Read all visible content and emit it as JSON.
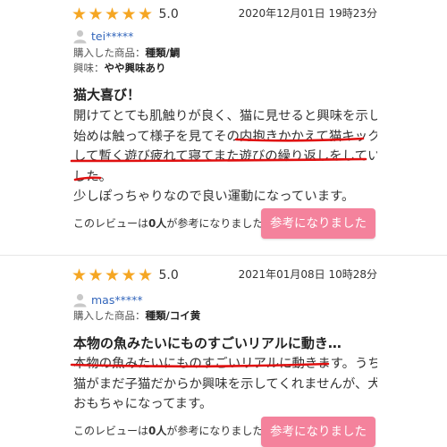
{
  "reviews": [
    {
      "rating_stars": 5,
      "rating": "5.0",
      "date": "2020年12月01日 19時23分",
      "user": "tei*****",
      "product_label": "購入した商品：",
      "product": "種類/鯛",
      "interest_label": "興味：",
      "interest": "やや興味あり",
      "title": "猫大喜び！",
      "body_lines": [
        "開けてとても肌触りが良く、猫に見せると興味を示して",
        "始めは触って様子を見てその内抱きかかえて猫キックを",
        "して暫く遊び疲れて寝てまた遊びの繰り返しをしていま",
        "した。",
        "少しぽっちゃりなので良い運動になっています。"
      ],
      "helpful_prefix": "このレビューは",
      "helpful_count": "0人",
      "helpful_suffix": "が参考になりました",
      "helpful_button": "参考になりました"
    },
    {
      "rating_stars": 5,
      "rating": "5.0",
      "date": "2021年01月08日 10時28分",
      "user": "mas*****",
      "product_label": "購入した商品：",
      "product": "種類/コイ黄",
      "title": "本物の魚みたいにものすごいリアルに動き…",
      "body_lines": [
        "本物の魚みたいにものすごいリアルに動きます。うちの",
        "猫がまだ子猫だからか興味を示してくれませんが、犬の",
        "おもちゃになってます。"
      ],
      "helpful_prefix": "このレビューは",
      "helpful_count": "0人",
      "helpful_suffix": "が参考になりました",
      "helpful_button": "参考になりました"
    }
  ],
  "colors": {
    "star": "#f5a623",
    "button": "#f4829c",
    "username": "#3366bb",
    "annotation": "#e01010"
  },
  "icons": {
    "star": "star-icon",
    "avatar": "user-avatar-icon"
  }
}
